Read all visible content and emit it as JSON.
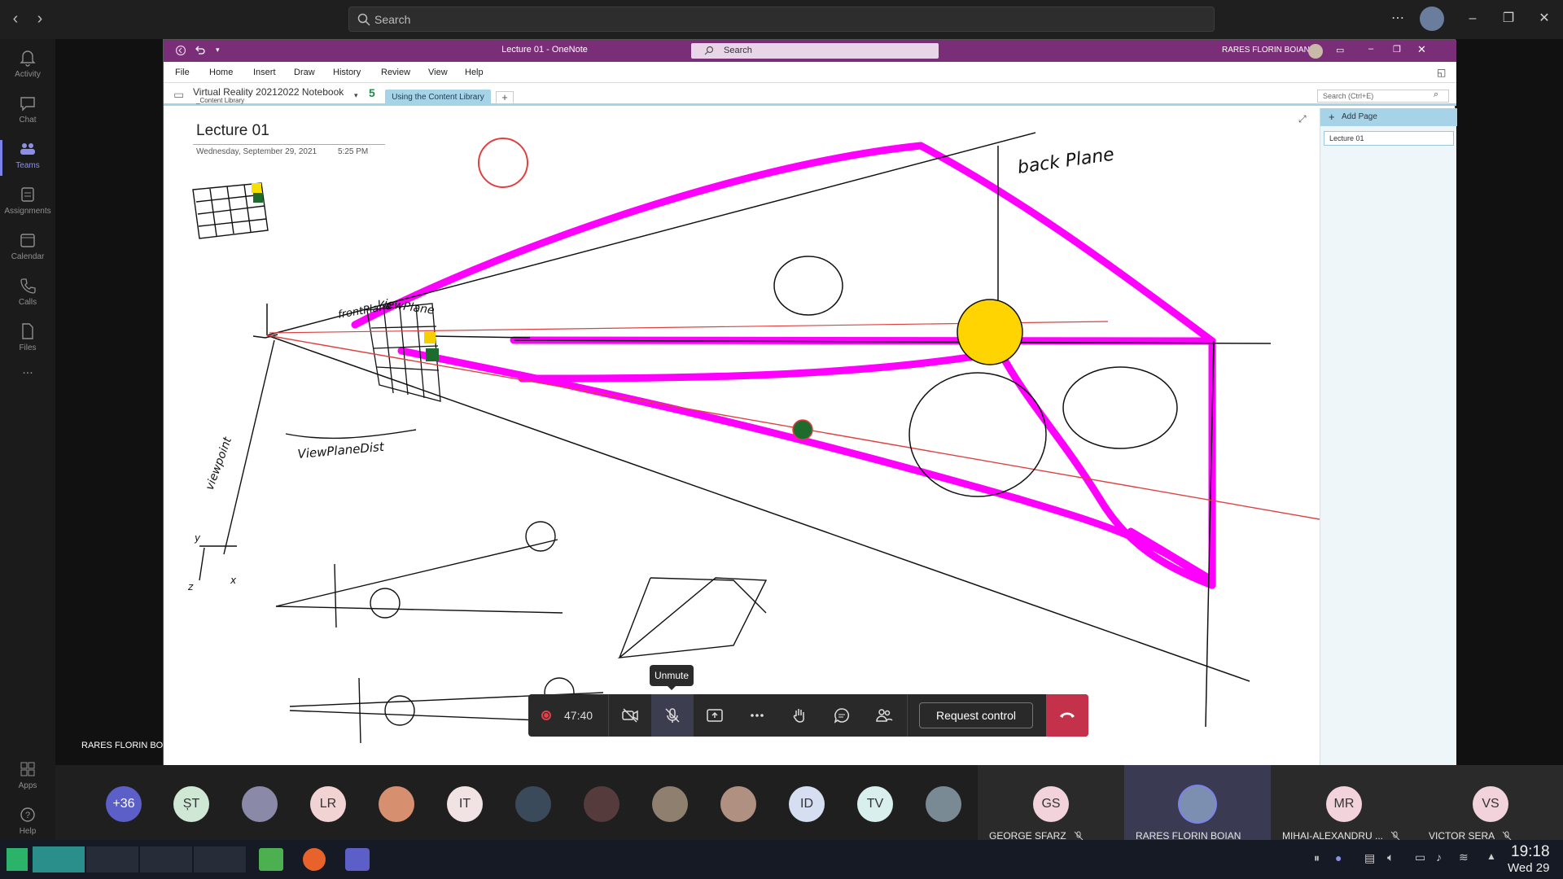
{
  "teams": {
    "search_placeholder": "Search",
    "rail": [
      {
        "label": "Activity",
        "icon": "bell-icon"
      },
      {
        "label": "Chat",
        "icon": "chat-icon"
      },
      {
        "label": "Teams",
        "icon": "teams-icon"
      },
      {
        "label": "Assignments",
        "icon": "assignments-icon"
      },
      {
        "label": "Calendar",
        "icon": "calendar-icon"
      },
      {
        "label": "Calls",
        "icon": "phone-icon"
      },
      {
        "label": "Files",
        "icon": "file-icon"
      },
      {
        "label": "...",
        "icon": "more-icon"
      },
      {
        "label": "Apps",
        "icon": "apps-icon"
      },
      {
        "label": "Help",
        "icon": "help-icon"
      }
    ],
    "accent": "#7b83eb"
  },
  "onenote": {
    "window_title": "Lecture 01  -  OneNote",
    "search_placeholder": "Search",
    "user_name": "RARES FLORIN BOIAN",
    "menu": [
      "File",
      "Home",
      "Insert",
      "Draw",
      "History",
      "Review",
      "View",
      "Help"
    ],
    "notebook_name": "Virtual Reality 20212022 Notebook",
    "notebook_sub": "_Content Library",
    "section_number": "5",
    "section_tab": "Using the Content Library",
    "add_tab": "+",
    "nb_search_placeholder": "Search (Ctrl+E)",
    "add_page": "Add Page",
    "pages": [
      "Lecture 01"
    ],
    "page_title": "Lecture 01",
    "page_date": "Wednesday, September 29, 2021",
    "page_time": "5:25 PM",
    "title_bar_color": "#7b2e78",
    "ink_color": "#ff00ff",
    "ink_labels": {
      "back_plane": "back Plane",
      "front_plane": "frontPlane",
      "view_plane": "viewPlane",
      "view_plane_dist": "ViewPlaneDist",
      "viewpoint": "viewpoint",
      "axis_y": "y",
      "axis_x": "x",
      "axis_z": "z"
    }
  },
  "call": {
    "tooltip": "Unmute",
    "timer": "47:40",
    "request_control": "Request control",
    "sharer_name": "RARES FLORIN BOIAN",
    "leave_color": "#c4314b"
  },
  "participants": {
    "overflow": "+36",
    "avatars": [
      {
        "initials": "ȘT",
        "color": "#cfe8d5"
      },
      {
        "initials": "",
        "color": "#8a8aa8"
      },
      {
        "initials": "LR",
        "color": "#f2d3d3"
      },
      {
        "initials": "",
        "color": "#d69070"
      },
      {
        "initials": "IT",
        "color": "#f1e3e3"
      },
      {
        "initials": "",
        "color": "#3a4a5a"
      },
      {
        "initials": "",
        "color": "#553b3b"
      },
      {
        "initials": "",
        "color": "#8f7f6f"
      },
      {
        "initials": "",
        "color": "#b09080"
      },
      {
        "initials": "ID",
        "color": "#d6dff2"
      },
      {
        "initials": "TV",
        "color": "#d8efee"
      },
      {
        "initials": "",
        "color": "#7a8a95"
      }
    ],
    "tiles": [
      {
        "initials": "GS",
        "name": "GEORGE SFARZ",
        "color": "#f2d3dc"
      },
      {
        "initials": "",
        "name": "RARES FLORIN BOIAN",
        "color": "#7d8fb0"
      },
      {
        "initials": "MR",
        "name": "MIHAI-ALEXANDRU ...",
        "color": "#f2d3dc"
      },
      {
        "initials": "VS",
        "name": "VICTOR SERA",
        "color": "#f2d3dc"
      }
    ]
  },
  "taskbar": {
    "time": "19:18",
    "date": "Wed 29"
  }
}
